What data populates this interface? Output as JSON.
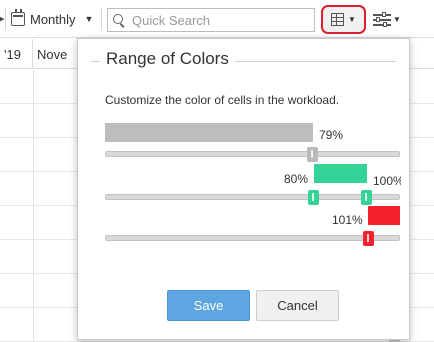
{
  "toolbar": {
    "period_label": "Monthly",
    "search_placeholder": "Quick Search"
  },
  "header": {
    "cells": [
      "'19",
      "Nove"
    ]
  },
  "popup": {
    "title": "Range of Colors",
    "description": "Customize the color of cells in the workload.",
    "ranges": [
      {
        "name": "low",
        "label": "79%",
        "color": "#bdbdbd",
        "value": 79
      },
      {
        "name": "mid",
        "label": "80%",
        "end_label": "100%",
        "color": "#36d399",
        "value": 80,
        "end_value": 100
      },
      {
        "name": "high",
        "label": "101%",
        "color": "#f5222d",
        "value": 101
      }
    ],
    "save_label": "Save",
    "cancel_label": "Cancel"
  },
  "colors": {
    "accent_highlight": "#d9202f",
    "save_button": "#5ea6e1"
  }
}
